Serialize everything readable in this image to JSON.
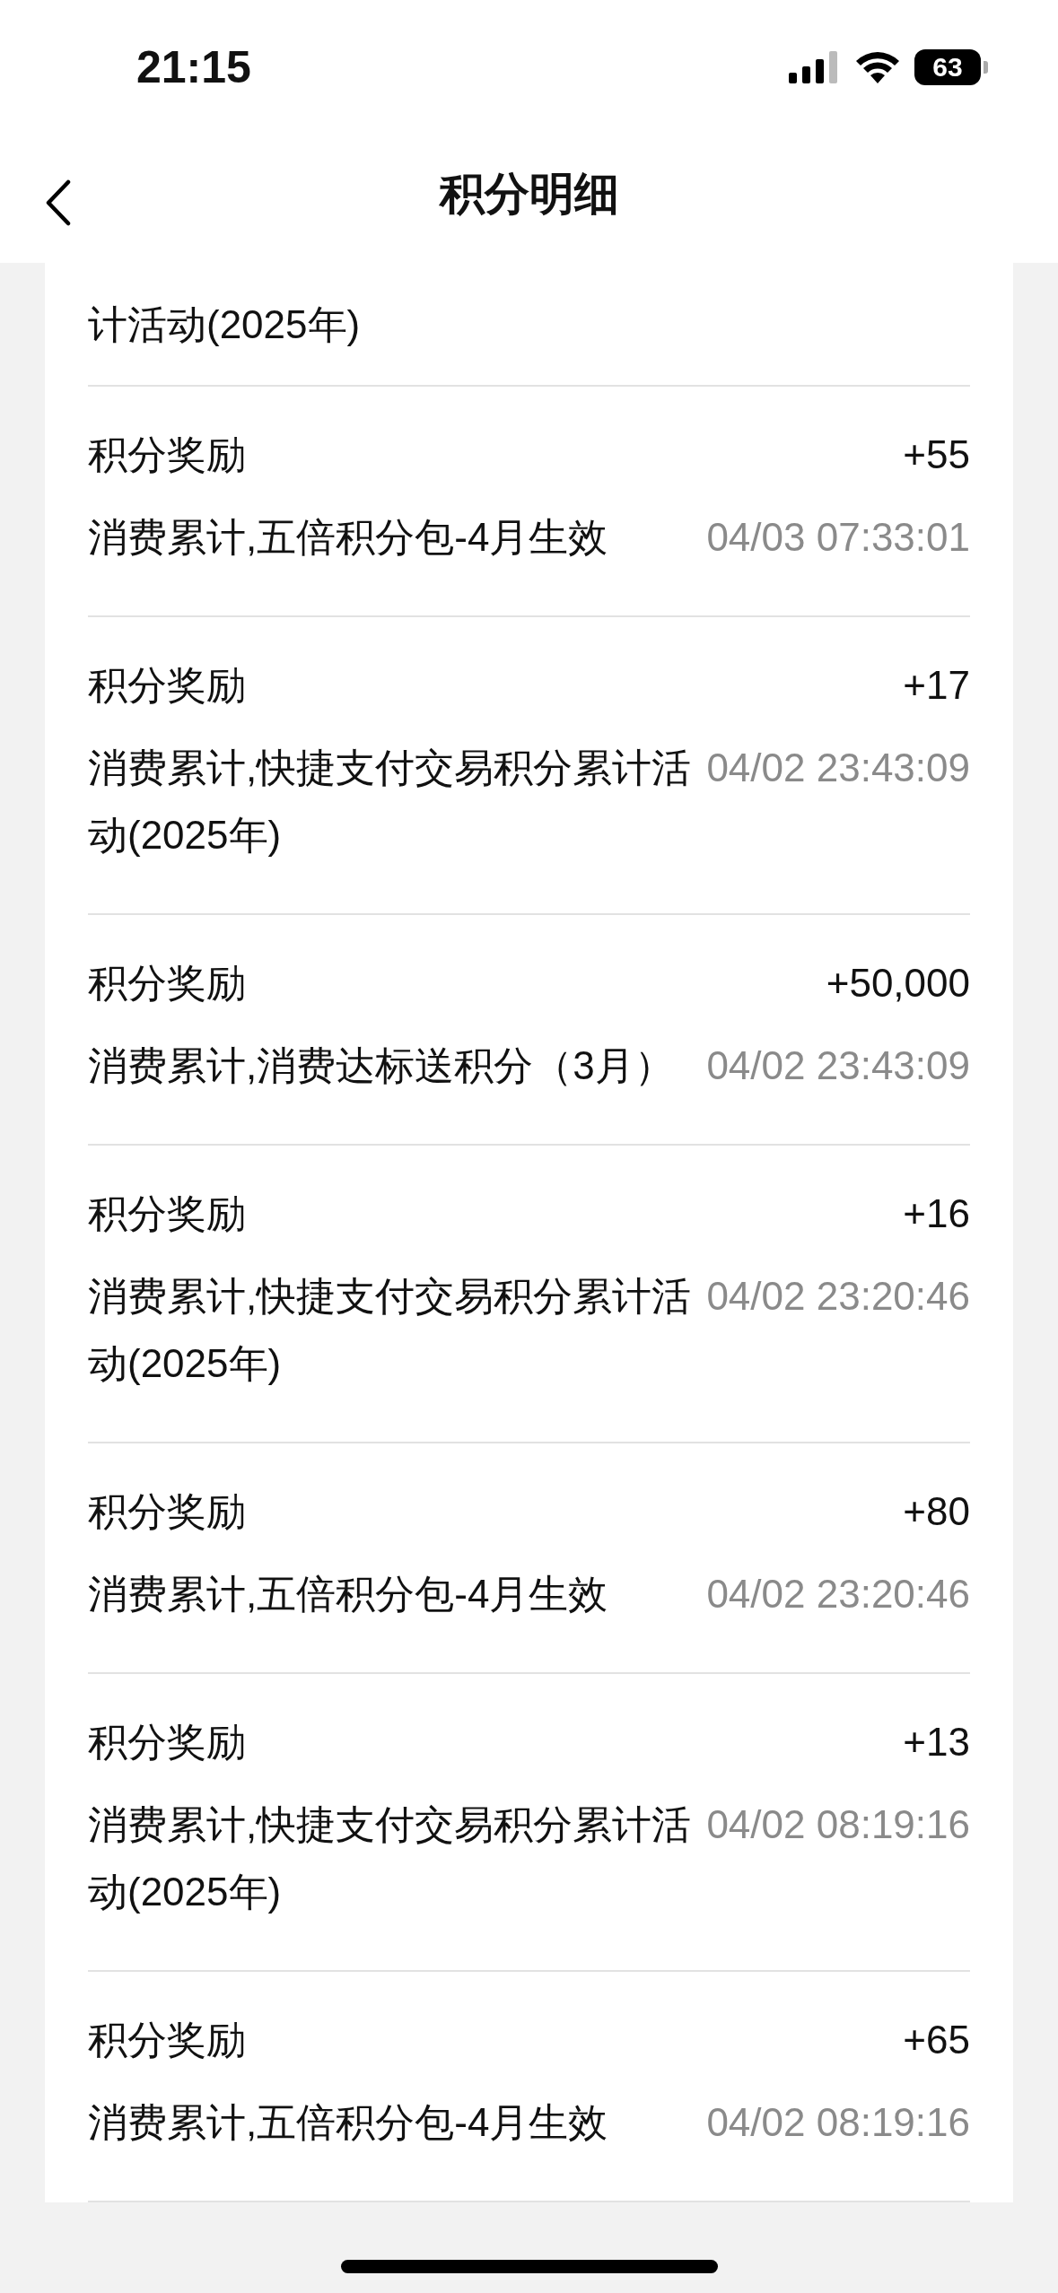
{
  "status_bar": {
    "time": "21:15",
    "battery": "63"
  },
  "header": {
    "title": "积分明细"
  },
  "partial_row": {
    "description": "计活动(2025年)"
  },
  "records": [
    {
      "title": "积分奖励",
      "amount": "+55",
      "description": "消费累计,五倍积分包-4月生效",
      "time": "04/03 07:33:01"
    },
    {
      "title": "积分奖励",
      "amount": "+17",
      "description": "消费累计,快捷支付交易积分累计活动(2025年)",
      "time": "04/02 23:43:09"
    },
    {
      "title": "积分奖励",
      "amount": "+50,000",
      "description": "消费累计,消费达标送积分（3月）",
      "time": "04/02 23:43:09"
    },
    {
      "title": "积分奖励",
      "amount": "+16",
      "description": "消费累计,快捷支付交易积分累计活动(2025年)",
      "time": "04/02 23:20:46"
    },
    {
      "title": "积分奖励",
      "amount": "+80",
      "description": "消费累计,五倍积分包-4月生效",
      "time": "04/02 23:20:46"
    },
    {
      "title": "积分奖励",
      "amount": "+13",
      "description": "消费累计,快捷支付交易积分累计活动(2025年)",
      "time": "04/02 08:19:16"
    },
    {
      "title": "积分奖励",
      "amount": "+65",
      "description": "消费累计,五倍积分包-4月生效",
      "time": "04/02 08:19:16"
    }
  ]
}
